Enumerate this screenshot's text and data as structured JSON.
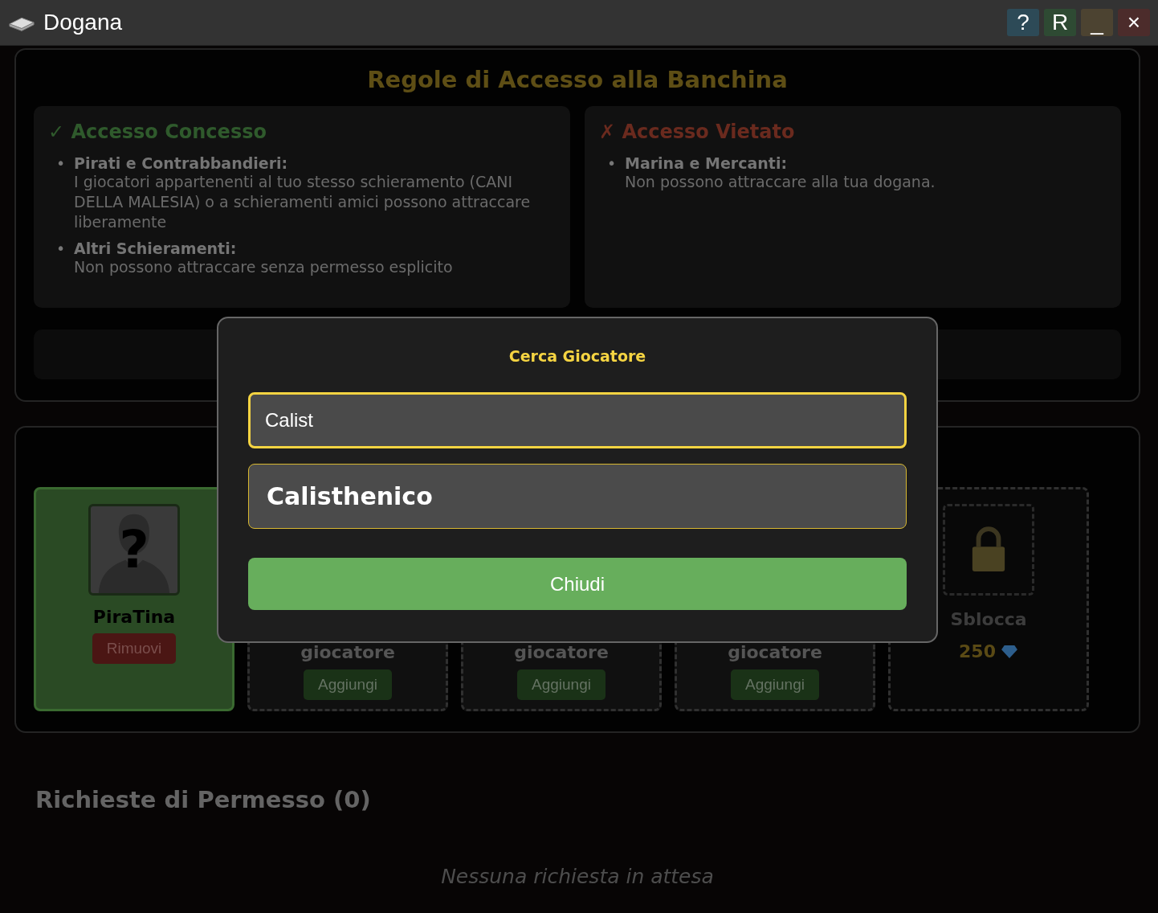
{
  "window": {
    "title": "Dogana",
    "buttons": [
      {
        "kind": "help",
        "label": "?"
      },
      {
        "kind": "reset",
        "label": "R"
      },
      {
        "kind": "minimize",
        "label": "_"
      },
      {
        "kind": "close",
        "label": "×"
      }
    ]
  },
  "rules": {
    "title": "Regole di Accesso alla Banchina",
    "sections": [
      {
        "kind": "allowed",
        "mark": "✓",
        "title": "Accesso Concesso",
        "bullet": "•",
        "items": [
          {
            "heading": "Pirati e Contrabbandieri:",
            "text": "I giocatori appartenenti al tuo stesso schieramento (CANI DELLA MALESIA) o a schieramenti amici possono attraccare liberamente"
          },
          {
            "heading": "Altri Schieramenti:",
            "text": "Non possono attraccare senza permesso esplicito"
          }
        ]
      },
      {
        "kind": "denied",
        "mark": "✗",
        "title": "Accesso Vietato",
        "bullet": "•",
        "items": [
          {
            "heading": "Marina e Mercanti:",
            "text": "Non possono attraccare alla tua dogana."
          }
        ]
      }
    ]
  },
  "slots_panel": {
    "slots": [
      {
        "kind": "player",
        "avatar_glyph": "?",
        "name": "PiraTina",
        "button": "Rimuovi"
      },
      {
        "kind": "empty",
        "label": "giocatore",
        "button": "Aggiungi"
      },
      {
        "kind": "empty",
        "label": "giocatore",
        "button": "Aggiungi"
      },
      {
        "kind": "empty",
        "label": "giocatore",
        "button": "Aggiungi"
      },
      {
        "kind": "locked",
        "label": "Sblocca",
        "price": "250"
      }
    ]
  },
  "requests": {
    "title": "Richieste di Permesso (0)",
    "empty_text": "Nessuna richiesta in attesa"
  },
  "modal": {
    "title": "Cerca Giocatore",
    "search_value": "Calist",
    "results": [
      {
        "name": "Calisthenico"
      }
    ],
    "close_button": "Chiudi"
  }
}
